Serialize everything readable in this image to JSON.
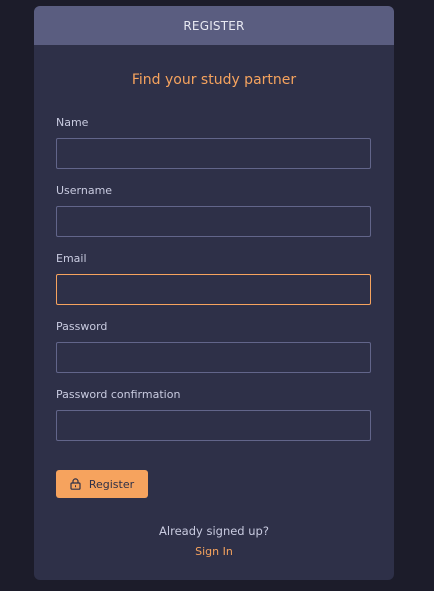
{
  "header": {
    "title": "REGISTER"
  },
  "form": {
    "heading": "Find your study partner",
    "fields": [
      {
        "label": "Name",
        "value": ""
      },
      {
        "label": "Username",
        "value": ""
      },
      {
        "label": "Email",
        "value": ""
      },
      {
        "label": "Password",
        "value": ""
      },
      {
        "label": "Password confirmation",
        "value": ""
      }
    ],
    "submit_label": "Register",
    "submit_icon": "lock-icon"
  },
  "footer": {
    "text": "Already signed up?",
    "link_label": "Sign In"
  },
  "colors": {
    "background": "#1c1c2a",
    "card": "#2e3048",
    "header": "#5a5d80",
    "accent": "#f6a35e"
  }
}
